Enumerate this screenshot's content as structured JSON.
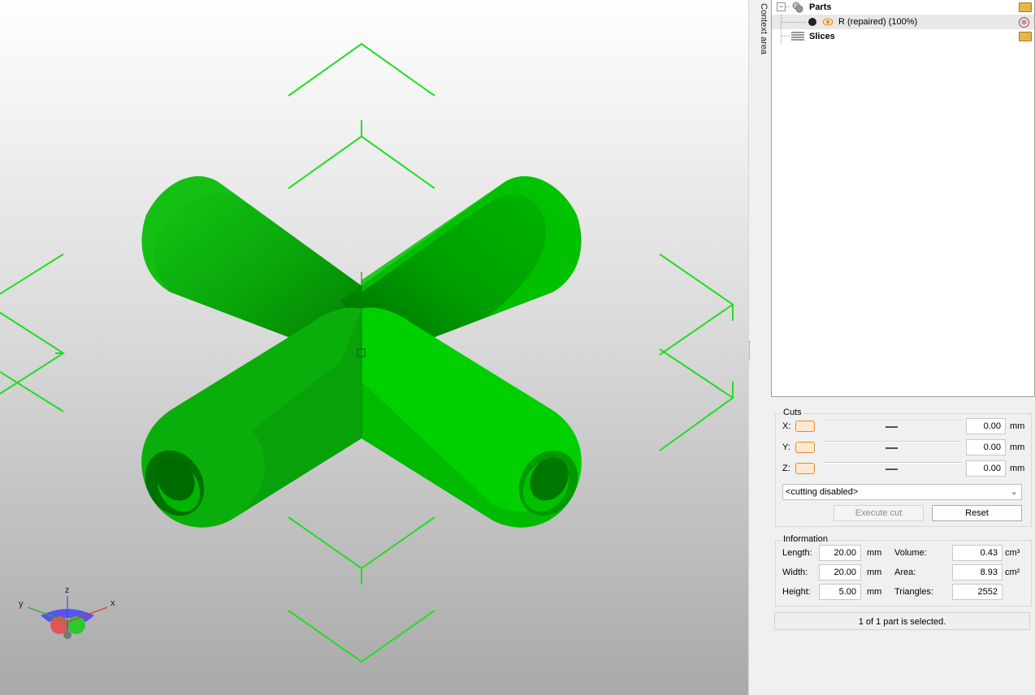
{
  "viewport": {
    "background_top": "#ffffff",
    "background_bottom": "#a9a9a9",
    "model_color": "#00d000",
    "handle_color": "#22dd22",
    "axes": {
      "x_label": "x",
      "y_label": "y",
      "z_label": "z"
    }
  },
  "context_area": {
    "label": "Context area"
  },
  "tree": {
    "parts": {
      "label": "Parts",
      "expander": "−",
      "icon": "parts-icon",
      "action_icon": "folder-open-icon"
    },
    "part_item": {
      "label": "R (repaired) (100%)",
      "icon": "visibility-icon",
      "action_icon": "remove-icon",
      "action_symbol": "⊗"
    },
    "slices": {
      "label": "Slices",
      "icon": "slices-icon",
      "action_icon": "folder-open-icon"
    }
  },
  "cuts": {
    "title": "Cuts",
    "rows": [
      {
        "axis": "X:",
        "value": "0.00",
        "unit": "mm"
      },
      {
        "axis": "Y:",
        "value": "0.00",
        "unit": "mm"
      },
      {
        "axis": "Z:",
        "value": "0.00",
        "unit": "mm"
      }
    ],
    "mode": "<cutting disabled>",
    "execute_label": "Execute cut",
    "reset_label": "Reset"
  },
  "information": {
    "title": "Information",
    "length_label": "Length:",
    "length_value": "20.00",
    "length_unit": "mm",
    "width_label": "Width:",
    "width_value": "20.00",
    "width_unit": "mm",
    "height_label": "Height:",
    "height_value": "5.00",
    "height_unit": "mm",
    "volume_label": "Volume:",
    "volume_value": "0.43",
    "volume_unit": "cm³",
    "area_label": "Area:",
    "area_value": "8.93",
    "area_unit": "cm²",
    "triangles_label": "Triangles:",
    "triangles_value": "2552"
  },
  "status": {
    "text": "1 of 1 part is selected."
  }
}
